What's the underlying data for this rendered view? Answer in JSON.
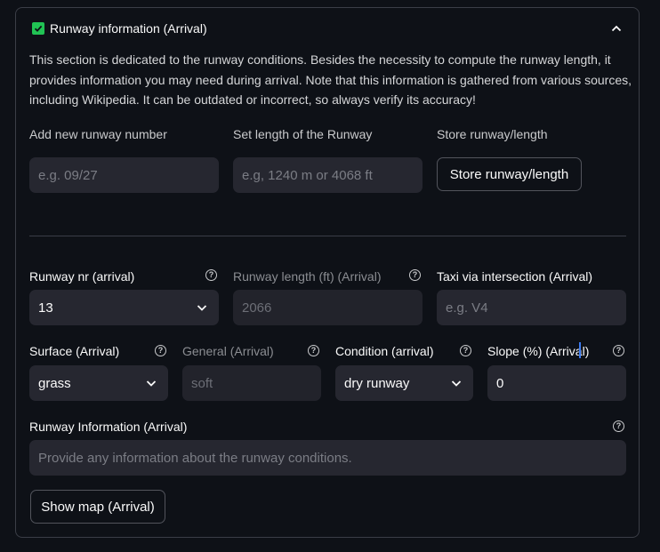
{
  "section": {
    "title": "Runway information (Arrival)",
    "description": "This section is dedicated to the runway conditions. Besides the necessity to compute the runway length, it provides information you may need during arrival. Note that this information is gathered from various sources, including Wikipedia. It can be outdated or incorrect, so always verify its accuracy!"
  },
  "add_runway": {
    "number_label": "Add new runway number",
    "number_placeholder": "e.g. 09/27",
    "length_label": "Set length of the Runway",
    "length_placeholder": "e.g, 1240 m or 4068 ft",
    "store_label": "Store runway/length",
    "store_button": "Store runway/length"
  },
  "runway": {
    "nr_label": "Runway nr (arrival)",
    "nr_value": "13",
    "length_label": "Runway length (ft) (Arrival)",
    "length_value": "2066",
    "taxi_label": "Taxi via intersection (Arrival)",
    "taxi_placeholder": "e.g. V4"
  },
  "surface": {
    "surface_label": "Surface (Arrival)",
    "surface_value": "grass",
    "general_label": "General (Arrival)",
    "general_value": "soft",
    "condition_label": "Condition (arrival)",
    "condition_value": "dry runway",
    "slope_label": "Slope (%) (Arrival)",
    "slope_value": "0"
  },
  "info": {
    "label": "Runway Information (Arrival)",
    "placeholder": "Provide any information about the runway conditions."
  },
  "map_button": "Show map (Arrival)",
  "colors": {
    "accent": "#21c354",
    "input_bg": "#262730",
    "border": "#3b3e47"
  }
}
